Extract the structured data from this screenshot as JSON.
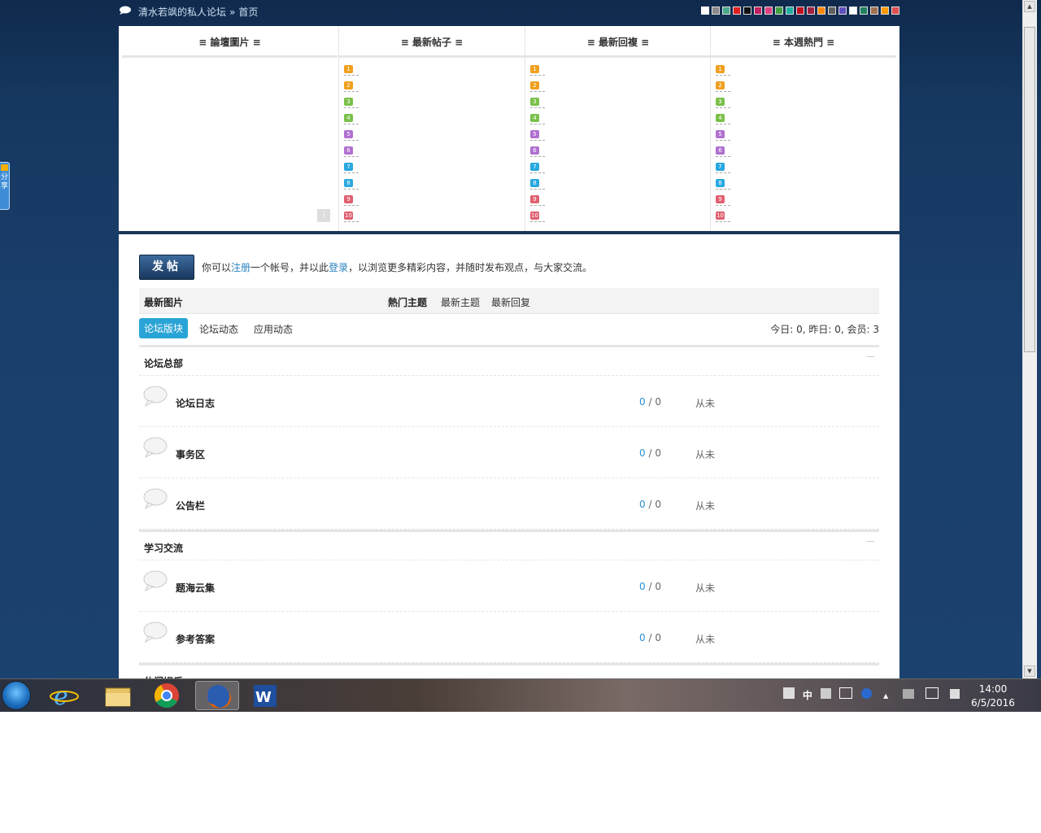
{
  "header": {
    "site_name": "清水若飒的私人论坛",
    "separator": "»",
    "current_page": "首页",
    "style_swatches": [
      "#ffffff",
      "#8a8a8a",
      "#4aa88a",
      "#e02020",
      "#111111",
      "#c02060",
      "#e04080",
      "#40a040",
      "#20b0a0",
      "#c01020",
      "#a02040",
      "#ff8800",
      "#606060",
      "#6050c0",
      "#ffffff",
      "#208060",
      "#a07050",
      "#ff9900",
      "#e05050"
    ]
  },
  "featured": {
    "col1_title": "≡ 論壇圖片 ≡",
    "col2_title": "≡ 最新帖子 ≡",
    "col3_title": "≡ 最新回複 ≡",
    "col4_title": "≡ 本週熱門 ≡",
    "ranks": [
      "1",
      "2",
      "3",
      "4",
      "5",
      "6",
      "7",
      "8",
      "9",
      "10"
    ],
    "pic_nav": "i"
  },
  "main": {
    "post_button": "发帖",
    "notice_pre": "你可以",
    "notice_register": "注册",
    "notice_mid": "一个帐号，并以此",
    "notice_login": "登录",
    "notice_post": "，以浏览更多精彩内容，并随时发布观点，与大家交流。",
    "tab_bar": {
      "latest_pics": "最新图片",
      "hot_topics": "熱门主题",
      "new_topics": "最新主题",
      "new_replies": "最新回复"
    },
    "subnav": {
      "active": "论坛版块",
      "dynamics": "论坛动态",
      "app_dynamics": "应用动态"
    },
    "stats": "今日: 0, 昨日: 0, 会员: 3",
    "categories": [
      {
        "title": "论坛总部",
        "forums": [
          {
            "name": "论坛日志",
            "threads": "0",
            "posts": "0",
            "last": "从未"
          },
          {
            "name": "事务区",
            "threads": "0",
            "posts": "0",
            "last": "从未"
          },
          {
            "name": "公告栏",
            "threads": "0",
            "posts": "0",
            "last": "从未"
          }
        ]
      },
      {
        "title": "学习交流",
        "forums": [
          {
            "name": "题海云集",
            "threads": "0",
            "posts": "0",
            "last": "从未"
          },
          {
            "name": "参考答案",
            "threads": "0",
            "posts": "0",
            "last": "从未"
          }
        ]
      }
    ],
    "cut_category": "休闲娱乐"
  },
  "share_tab": "分享",
  "taskbar": {
    "apps": [
      "start-orb",
      "internet-explorer",
      "file-explorer",
      "chrome",
      "firefox",
      "word"
    ],
    "tray_ime": "中",
    "clock_time": "14:00",
    "clock_date": "6/5/2016"
  }
}
